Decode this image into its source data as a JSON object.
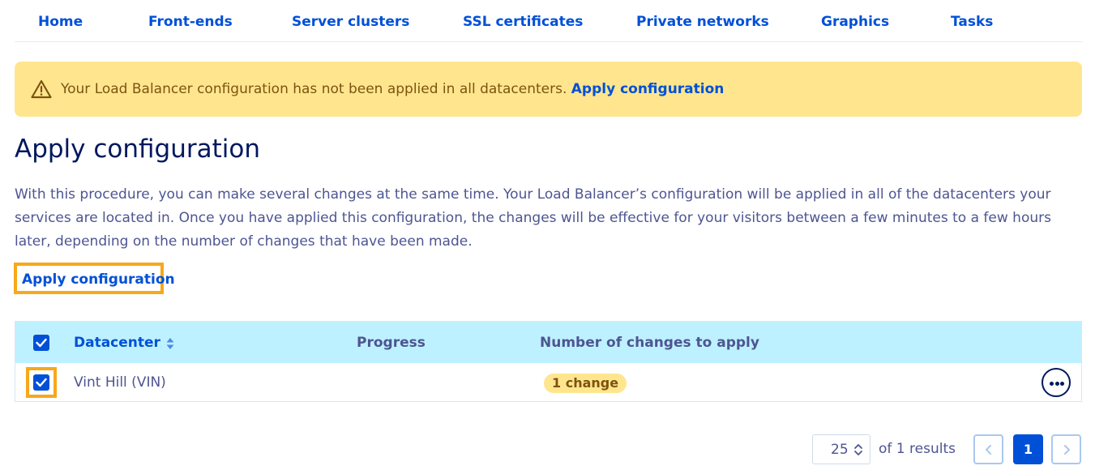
{
  "nav": {
    "items": [
      {
        "label": "Home"
      },
      {
        "label": "Front-ends"
      },
      {
        "label": "Server clusters"
      },
      {
        "label": "SSL certificates"
      },
      {
        "label": "Private networks"
      },
      {
        "label": "Graphics"
      },
      {
        "label": "Tasks"
      }
    ]
  },
  "banner": {
    "icon": "warning-triangle-icon",
    "message": "Your Load Balancer configuration has not been applied in all datacenters.",
    "link_label": "Apply configuration"
  },
  "page": {
    "title": "Apply configuration",
    "description": "With this procedure, you can make several changes at the same time. Your Load Balancer’s configuration will be applied in all of the datacenters your services are located in. Once you have applied this configuration, the changes will be effective for your visitors between a few minutes to a few hours later, depending on the number of changes that have been made.",
    "apply_link": "Apply configuration"
  },
  "table": {
    "columns": {
      "datacenter": "Datacenter",
      "progress": "Progress",
      "changes": "Number of changes to apply"
    },
    "select_all_checked": true,
    "rows": [
      {
        "checked": true,
        "datacenter": "Vint Hill (VIN)",
        "progress": "",
        "changes": "1 change"
      }
    ]
  },
  "pagination": {
    "page_size": "25",
    "results_text": "of 1 results",
    "current_page": "1"
  },
  "colors": {
    "accent": "#0050d7",
    "banner_bg": "#ffe68e",
    "header_bg": "#bef1ff",
    "highlight": "#f7a81b",
    "title": "#00185e"
  }
}
